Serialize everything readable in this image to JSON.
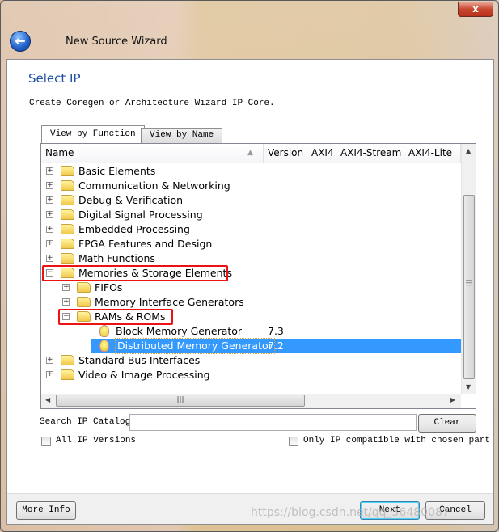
{
  "window": {
    "title": "New Source Wizard",
    "close_label": "x"
  },
  "page": {
    "heading": "Select IP",
    "description": "Create Coregen or Architecture Wizard IP Core."
  },
  "tabs": [
    {
      "label": "View by Function",
      "active": true
    },
    {
      "label": "View by Name",
      "active": false
    }
  ],
  "columns": [
    "Name",
    "Version",
    "AXI4",
    "AXI4-Stream",
    "AXI4-Lite"
  ],
  "tree": [
    {
      "label": "Basic Elements",
      "type": "folder",
      "level": 0,
      "expanded": false
    },
    {
      "label": "Communication & Networking",
      "type": "folder",
      "level": 0,
      "expanded": false
    },
    {
      "label": "Debug & Verification",
      "type": "folder",
      "level": 0,
      "expanded": false
    },
    {
      "label": "Digital Signal Processing",
      "type": "folder",
      "level": 0,
      "expanded": false
    },
    {
      "label": "Embedded Processing",
      "type": "folder",
      "level": 0,
      "expanded": false
    },
    {
      "label": "FPGA Features and Design",
      "type": "folder",
      "level": 0,
      "expanded": false
    },
    {
      "label": "Math Functions",
      "type": "folder",
      "level": 0,
      "expanded": false
    },
    {
      "label": "Memories & Storage Elements",
      "type": "folder",
      "level": 0,
      "expanded": true,
      "highlighted": true
    },
    {
      "label": "FIFOs",
      "type": "folder",
      "level": 1,
      "expanded": false
    },
    {
      "label": "Memory Interface Generators",
      "type": "folder",
      "level": 1,
      "expanded": false
    },
    {
      "label": "RAMs & ROMs",
      "type": "folder",
      "level": 1,
      "expanded": true,
      "highlighted": true
    },
    {
      "label": "Block Memory Generator",
      "type": "ip",
      "level": 2,
      "version": "7.3"
    },
    {
      "label": "Distributed Memory Generator",
      "type": "ip",
      "level": 2,
      "version": "7.2",
      "selected": true
    },
    {
      "label": "Standard Bus Interfaces",
      "type": "folder",
      "level": 0,
      "expanded": false
    },
    {
      "label": "Video & Image Processing",
      "type": "folder",
      "level": 0,
      "expanded": false
    }
  ],
  "search": {
    "label": "Search IP Catalog:",
    "value": "",
    "clear_label": "Clear"
  },
  "options": {
    "all_versions": "All IP versions",
    "all_versions_checked": false,
    "compatible_only": "Only IP compatible with chosen part",
    "compatible_checked": false
  },
  "buttons": {
    "more_info": "More Info",
    "next": "Next",
    "cancel": "Cancel"
  },
  "watermark": "https://blog.csdn.net/qq_36480087",
  "colors": {
    "selection": "#3399ff",
    "heading": "#1e4fa3",
    "highlight_box": "#ee1111"
  }
}
